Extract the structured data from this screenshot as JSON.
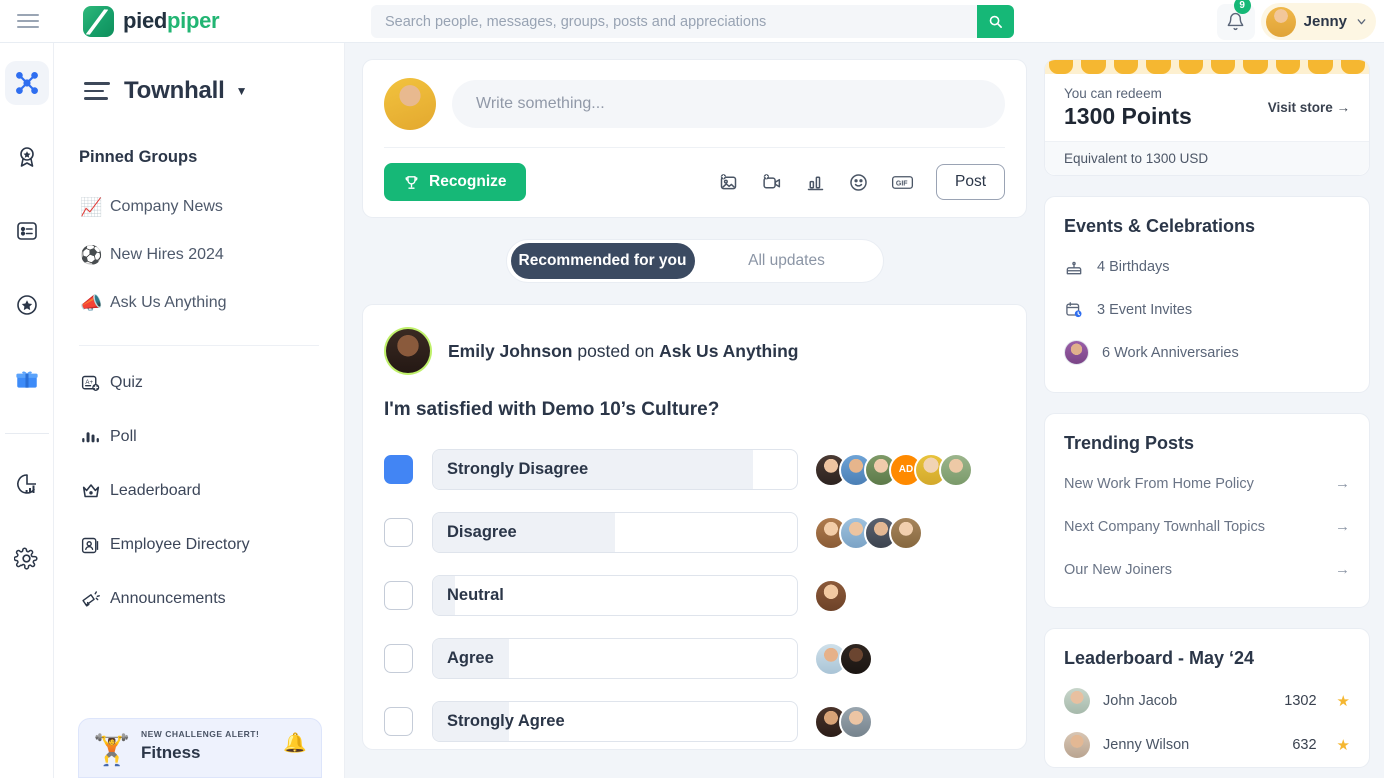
{
  "topbar": {
    "menu_icon": "hamburger-icon",
    "brand_part1": "pied",
    "brand_part2": "piper",
    "search_placeholder": "Search people, messages, groups, posts and appreciations",
    "search_icon": "search-icon",
    "notification_icon": "bell-icon",
    "notification_count": "9",
    "user_name": "Jenny",
    "user_caret": "chevron-down-icon"
  },
  "rail": {
    "items": [
      {
        "name": "network-icon",
        "active": true
      },
      {
        "name": "award-badge-icon",
        "active": false
      },
      {
        "name": "survey-list-icon",
        "active": false
      },
      {
        "name": "star-circle-icon",
        "active": false
      },
      {
        "name": "gift-icon",
        "active": false
      },
      {
        "name": "analytics-icon",
        "active": false
      },
      {
        "name": "settings-gear-icon",
        "active": false
      }
    ]
  },
  "left_panel": {
    "workspace_title": "Townhall",
    "workspace_caret": "caret-down-icon",
    "pinned_title": "Pinned Groups",
    "pinned_groups": [
      {
        "emoji": "📈",
        "label": "Company News"
      },
      {
        "emoji": "⚽",
        "label": "New Hires 2024"
      },
      {
        "emoji": "📣",
        "label": "Ask Us Anything"
      }
    ],
    "nav_items": [
      {
        "icon": "quiz-icon",
        "label": "Quiz"
      },
      {
        "icon": "poll-icon",
        "label": "Poll"
      },
      {
        "icon": "leaderboard-crown-icon",
        "label": "Leaderboard"
      },
      {
        "icon": "employee-directory-icon",
        "label": "Employee Directory"
      },
      {
        "icon": "announcement-megaphone-icon",
        "label": "Announcements"
      }
    ],
    "challenge": {
      "alert_label": "NEW CHALLENGE ALERT!",
      "title": "Fitness",
      "kettlebell_emoji": "🏋️",
      "bell_emoji": "🔔"
    }
  },
  "composer": {
    "placeholder": "Write something...",
    "recognize_label": "Recognize",
    "recognize_icon": "trophy-icon",
    "post_label": "Post",
    "actions": [
      {
        "icon": "add-image-icon"
      },
      {
        "icon": "add-video-icon"
      },
      {
        "icon": "add-poll-icon"
      },
      {
        "icon": "emoji-icon"
      },
      {
        "icon": "gif-icon"
      }
    ]
  },
  "feed_tabs": {
    "recommended_label": "Recommended for you",
    "all_updates_label": "All updates",
    "active": "Recommended for you"
  },
  "post": {
    "author": "Emily Johnson",
    "action_text": "posted on",
    "group": "Ask Us Anything",
    "question": "I'm satisfied with Demo 10’s Culture?",
    "options": [
      {
        "label": "Strongly Disagree",
        "percent": 88,
        "selected": true,
        "voters": 6,
        "extra_badge": "AD"
      },
      {
        "label": "Disagree",
        "percent": 50,
        "selected": false,
        "voters": 4,
        "extra_badge": ""
      },
      {
        "label": "Neutral",
        "percent": 6,
        "selected": false,
        "voters": 1,
        "extra_badge": ""
      },
      {
        "label": "Agree",
        "percent": 21,
        "selected": false,
        "voters": 2,
        "extra_badge": ""
      },
      {
        "label": "Strongly Agree",
        "percent": 21,
        "selected": false,
        "voters": 2,
        "extra_badge": ""
      }
    ]
  },
  "points_card": {
    "redeem_text": "You can redeem",
    "points": "1300 Points",
    "visit_store": "Visit store →",
    "equivalent": "Equivalent to 1300 USD"
  },
  "events_card": {
    "title": "Events & Celebrations",
    "items": [
      {
        "icon": "birthday-cake-icon",
        "label": "4 Birthdays"
      },
      {
        "icon": "calendar-clock-icon",
        "label": "3 Event Invites"
      },
      {
        "icon": "avatar-icon",
        "label": "6 Work Anniversaries"
      }
    ]
  },
  "trending_card": {
    "title": "Trending Posts",
    "items": [
      {
        "label": "New Work From Home Policy",
        "arrow": "→"
      },
      {
        "label": "Next Company Townhall Topics",
        "arrow": "→"
      },
      {
        "label": "Our New Joiners",
        "arrow": "→"
      }
    ]
  },
  "leaderboard_card": {
    "title": "Leaderboard - May ‘24",
    "rows": [
      {
        "name": "John Jacob",
        "points": "1302",
        "star": "★"
      },
      {
        "name": "Jenny Wilson",
        "points": "632",
        "star": "★"
      }
    ]
  },
  "colors": {
    "brand_green": "#16b877",
    "accent_blue": "#4285f4",
    "dark_navy": "#3b4a61",
    "points_orange": "#f5b731",
    "star_gold": "#f5b731"
  }
}
